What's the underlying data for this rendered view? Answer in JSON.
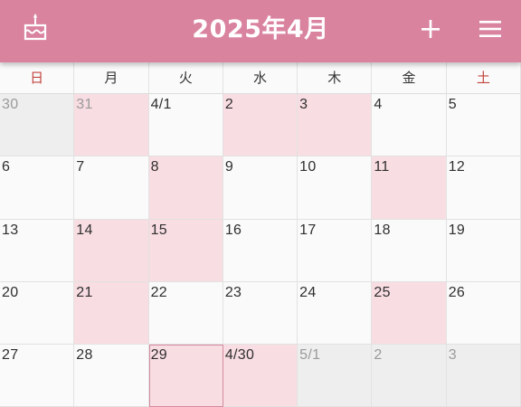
{
  "header": {
    "title": "2025年4月",
    "background": "#d9839f",
    "left_icon": "birthday-cake-icon",
    "add_icon": "plus-icon",
    "menu_icon": "hamburger-menu-icon"
  },
  "weekdays": [
    {
      "label": "日",
      "weekend": true
    },
    {
      "label": "月",
      "weekend": false
    },
    {
      "label": "火",
      "weekend": false
    },
    {
      "label": "水",
      "weekend": false
    },
    {
      "label": "木",
      "weekend": false
    },
    {
      "label": "金",
      "weekend": false
    },
    {
      "label": "土",
      "weekend": true
    }
  ],
  "colors": {
    "highlight": "#f8dde2",
    "out_of_month": "#eeeeee",
    "weekend_label": "#c2453f"
  },
  "weeks": [
    [
      {
        "label": "30",
        "out": true,
        "shade": "gray"
      },
      {
        "label": "31",
        "out": true,
        "shade": "pink"
      },
      {
        "label": "4/1",
        "out": false,
        "shade": "none"
      },
      {
        "label": "2",
        "out": false,
        "shade": "pink"
      },
      {
        "label": "3",
        "out": false,
        "shade": "pink"
      },
      {
        "label": "4",
        "out": false,
        "shade": "none"
      },
      {
        "label": "5",
        "out": false,
        "shade": "none"
      }
    ],
    [
      {
        "label": "6",
        "out": false,
        "shade": "none"
      },
      {
        "label": "7",
        "out": false,
        "shade": "none"
      },
      {
        "label": "8",
        "out": false,
        "shade": "pink"
      },
      {
        "label": "9",
        "out": false,
        "shade": "none"
      },
      {
        "label": "10",
        "out": false,
        "shade": "none"
      },
      {
        "label": "11",
        "out": false,
        "shade": "pink"
      },
      {
        "label": "12",
        "out": false,
        "shade": "none"
      }
    ],
    [
      {
        "label": "13",
        "out": false,
        "shade": "none"
      },
      {
        "label": "14",
        "out": false,
        "shade": "pink"
      },
      {
        "label": "15",
        "out": false,
        "shade": "pink"
      },
      {
        "label": "16",
        "out": false,
        "shade": "none"
      },
      {
        "label": "17",
        "out": false,
        "shade": "none"
      },
      {
        "label": "18",
        "out": false,
        "shade": "none"
      },
      {
        "label": "19",
        "out": false,
        "shade": "none"
      }
    ],
    [
      {
        "label": "20",
        "out": false,
        "shade": "none"
      },
      {
        "label": "21",
        "out": false,
        "shade": "pink"
      },
      {
        "label": "22",
        "out": false,
        "shade": "none"
      },
      {
        "label": "23",
        "out": false,
        "shade": "none"
      },
      {
        "label": "24",
        "out": false,
        "shade": "none"
      },
      {
        "label": "25",
        "out": false,
        "shade": "pink"
      },
      {
        "label": "26",
        "out": false,
        "shade": "none"
      }
    ],
    [
      {
        "label": "27",
        "out": false,
        "shade": "none"
      },
      {
        "label": "28",
        "out": false,
        "shade": "none"
      },
      {
        "label": "29",
        "out": false,
        "shade": "pink",
        "today": true
      },
      {
        "label": "4/30",
        "out": false,
        "shade": "pink"
      },
      {
        "label": "5/1",
        "out": true,
        "shade": "gray"
      },
      {
        "label": "2",
        "out": true,
        "shade": "gray"
      },
      {
        "label": "3",
        "out": true,
        "shade": "gray"
      }
    ]
  ]
}
